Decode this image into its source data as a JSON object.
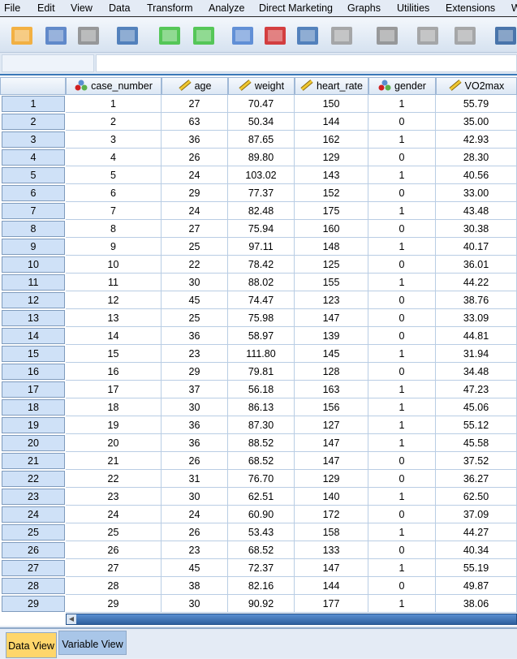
{
  "menu": [
    "File",
    "Edit",
    "View",
    "Data",
    "Transform",
    "Analyze",
    "Direct Marketing",
    "Graphs",
    "Utilities",
    "Extensions",
    "W"
  ],
  "toolbar": [
    "open-folder-icon",
    "save-icon",
    "print-icon",
    "dialog-recall-icon",
    "undo-icon",
    "redo-icon",
    "goto-case-icon",
    "goto-variable-icon",
    "variables-icon",
    "descriptives-icon",
    "find-icon",
    "insert-cases-icon",
    "insert-variable-icon",
    "split-file-icon"
  ],
  "cell_editor": {
    "name": "",
    "value": ""
  },
  "columns": [
    {
      "name": "case_number",
      "type": "nominal"
    },
    {
      "name": "age",
      "type": "scale"
    },
    {
      "name": "weight",
      "type": "scale"
    },
    {
      "name": "heart_rate",
      "type": "scale"
    },
    {
      "name": "gender",
      "type": "nominal"
    },
    {
      "name": "VO2max",
      "type": "scale"
    }
  ],
  "rows": [
    [
      "1",
      "27",
      "70.47",
      "150",
      "1",
      "55.79"
    ],
    [
      "2",
      "63",
      "50.34",
      "144",
      "0",
      "35.00"
    ],
    [
      "3",
      "36",
      "87.65",
      "162",
      "1",
      "42.93"
    ],
    [
      "4",
      "26",
      "89.80",
      "129",
      "0",
      "28.30"
    ],
    [
      "5",
      "24",
      "103.02",
      "143",
      "1",
      "40.56"
    ],
    [
      "6",
      "29",
      "77.37",
      "152",
      "0",
      "33.00"
    ],
    [
      "7",
      "24",
      "82.48",
      "175",
      "1",
      "43.48"
    ],
    [
      "8",
      "27",
      "75.94",
      "160",
      "0",
      "30.38"
    ],
    [
      "9",
      "25",
      "97.11",
      "148",
      "1",
      "40.17"
    ],
    [
      "10",
      "22",
      "78.42",
      "125",
      "0",
      "36.01"
    ],
    [
      "11",
      "30",
      "88.02",
      "155",
      "1",
      "44.22"
    ],
    [
      "12",
      "45",
      "74.47",
      "123",
      "0",
      "38.76"
    ],
    [
      "13",
      "25",
      "75.98",
      "147",
      "0",
      "33.09"
    ],
    [
      "14",
      "36",
      "58.97",
      "139",
      "0",
      "44.81"
    ],
    [
      "15",
      "23",
      "111.80",
      "145",
      "1",
      "31.94"
    ],
    [
      "16",
      "29",
      "79.81",
      "128",
      "0",
      "34.48"
    ],
    [
      "17",
      "37",
      "56.18",
      "163",
      "1",
      "47.23"
    ],
    [
      "18",
      "30",
      "86.13",
      "156",
      "1",
      "45.06"
    ],
    [
      "19",
      "36",
      "87.30",
      "127",
      "1",
      "55.12"
    ],
    [
      "20",
      "36",
      "88.52",
      "147",
      "1",
      "45.58"
    ],
    [
      "21",
      "26",
      "68.52",
      "147",
      "0",
      "37.52"
    ],
    [
      "22",
      "31",
      "76.70",
      "129",
      "0",
      "36.27"
    ],
    [
      "23",
      "30",
      "62.51",
      "140",
      "1",
      "62.50"
    ],
    [
      "24",
      "24",
      "60.90",
      "172",
      "0",
      "37.09"
    ],
    [
      "25",
      "26",
      "53.43",
      "158",
      "1",
      "44.27"
    ],
    [
      "26",
      "23",
      "68.52",
      "133",
      "0",
      "40.34"
    ],
    [
      "27",
      "45",
      "72.37",
      "147",
      "1",
      "55.19"
    ],
    [
      "28",
      "38",
      "82.16",
      "144",
      "0",
      "49.87"
    ],
    [
      "29",
      "30",
      "90.92",
      "177",
      "1",
      "38.06"
    ]
  ],
  "row_numbers": [
    "1",
    "2",
    "3",
    "4",
    "5",
    "6",
    "7",
    "8",
    "9",
    "10",
    "11",
    "12",
    "13",
    "14",
    "15",
    "16",
    "17",
    "18",
    "19",
    "20",
    "21",
    "22",
    "23",
    "24",
    "25",
    "26",
    "27",
    "28",
    "29"
  ],
  "tabs": [
    {
      "label": "Data View",
      "active": true
    },
    {
      "label": "Variable View",
      "active": false
    }
  ],
  "colors": {
    "active_tab": "#ffd66b",
    "row_header": "#cfe1f7",
    "scrollbar": "#3a6fb2"
  }
}
